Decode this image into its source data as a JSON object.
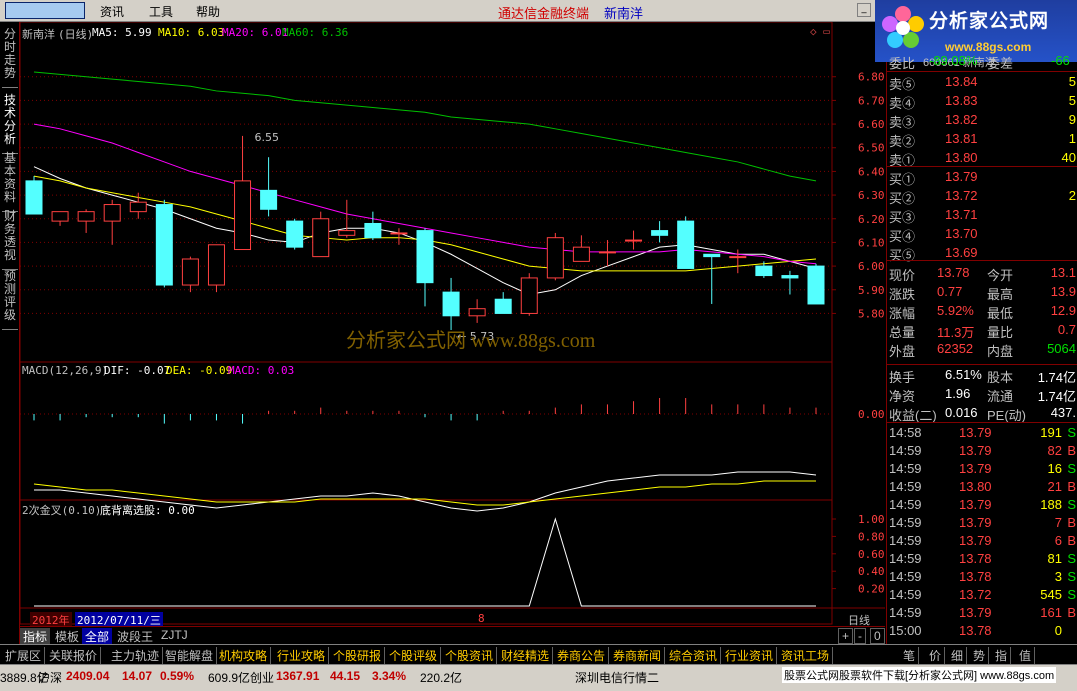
{
  "menu": {
    "items": [
      "资讯",
      "工具",
      "帮助"
    ],
    "app_title": "通达信金融终端",
    "stock_name": "新南洋",
    "min_button": "_"
  },
  "logo": {
    "text": "分析家公式网",
    "url": "www.88gs.com",
    "watermark": "分析家公式网 www.88gs.com"
  },
  "left_tabs": [
    "分时走势",
    "技术分析",
    "基本资料",
    "财务透视",
    "预测评级"
  ],
  "main_chart": {
    "header": {
      "name": "新南洋",
      "period": "(日线)",
      "ma5": "MA5: 5.99",
      "ma10": "MA10: 6.03",
      "ma20": "MA20: 6.01",
      "ma60": "MA60: 6.36"
    },
    "marks": {
      "high": "6.55",
      "low": "5.73"
    },
    "y_ticks": [
      "6.80",
      "6.70",
      "6.60",
      "6.50",
      "6.40",
      "6.30",
      "6.20",
      "6.10",
      "6.00",
      "5.90",
      "5.80"
    ]
  },
  "macd_panel": {
    "header": {
      "name": "MACD(12,26,9)",
      "dif": "DIF: -0.07",
      "dea": "DEA: -0.09",
      "macd": "MACD: 0.03"
    },
    "y_tick": "0.00"
  },
  "signal_panel": {
    "header": {
      "name": "2次金叉(0.10)",
      "value": "底背离选股: 0.00"
    },
    "y_ticks": [
      "1.00",
      "0.80",
      "0.60",
      "0.40",
      "0.20"
    ]
  },
  "time_axis": {
    "year": "2012年",
    "cursor_date": "2012/07/11/三",
    "month": "8",
    "period": "日线"
  },
  "chart_data": [
    {
      "type": "candlestick",
      "title": "新南洋(日线)",
      "ylim": [
        5.73,
        6.82
      ],
      "candles": [
        {
          "o": 6.36,
          "h": 6.38,
          "l": 6.22,
          "c": 6.22
        },
        {
          "o": 6.19,
          "h": 6.23,
          "l": 6.17,
          "c": 6.23
        },
        {
          "o": 6.19,
          "h": 6.24,
          "l": 6.14,
          "c": 6.23
        },
        {
          "o": 6.19,
          "h": 6.28,
          "l": 6.09,
          "c": 6.26
        },
        {
          "o": 6.23,
          "h": 6.31,
          "l": 6.2,
          "c": 6.27
        },
        {
          "o": 6.26,
          "h": 6.28,
          "l": 5.91,
          "c": 5.92
        },
        {
          "o": 5.92,
          "h": 6.04,
          "l": 5.89,
          "c": 6.03
        },
        {
          "o": 5.92,
          "h": 6.08,
          "l": 5.89,
          "c": 6.09
        },
        {
          "o": 6.07,
          "h": 6.55,
          "l": 6.07,
          "c": 6.36
        },
        {
          "o": 6.32,
          "h": 6.46,
          "l": 6.21,
          "c": 6.24
        },
        {
          "o": 6.19,
          "h": 6.2,
          "l": 6.07,
          "c": 6.08
        },
        {
          "o": 6.04,
          "h": 6.23,
          "l": 6.04,
          "c": 6.2
        },
        {
          "o": 6.13,
          "h": 6.28,
          "l": 6.12,
          "c": 6.15
        },
        {
          "o": 6.18,
          "h": 6.23,
          "l": 6.11,
          "c": 6.12
        },
        {
          "o": 6.14,
          "h": 6.16,
          "l": 6.09,
          "c": 6.14
        },
        {
          "o": 6.15,
          "h": 6.16,
          "l": 5.83,
          "c": 5.93
        },
        {
          "o": 5.89,
          "h": 5.95,
          "l": 5.73,
          "c": 5.79
        },
        {
          "o": 5.79,
          "h": 5.86,
          "l": 5.76,
          "c": 5.82
        },
        {
          "o": 5.86,
          "h": 5.89,
          "l": 5.8,
          "c": 5.8
        },
        {
          "o": 5.8,
          "h": 5.97,
          "l": 5.79,
          "c": 5.95
        },
        {
          "o": 5.95,
          "h": 6.14,
          "l": 5.94,
          "c": 6.12
        },
        {
          "o": 6.02,
          "h": 6.13,
          "l": 6.02,
          "c": 6.08
        },
        {
          "o": 6.06,
          "h": 6.11,
          "l": 6.0,
          "c": 6.06
        },
        {
          "o": 6.11,
          "h": 6.15,
          "l": 6.07,
          "c": 6.11
        },
        {
          "o": 6.15,
          "h": 6.19,
          "l": 6.1,
          "c": 6.13
        },
        {
          "o": 6.19,
          "h": 6.21,
          "l": 6.0,
          "c": 5.99
        },
        {
          "o": 6.05,
          "h": 6.05,
          "l": 5.84,
          "c": 6.04
        },
        {
          "o": 6.04,
          "h": 6.07,
          "l": 5.97,
          "c": 6.04
        },
        {
          "o": 6.0,
          "h": 6.02,
          "l": 5.95,
          "c": 5.96
        },
        {
          "o": 5.96,
          "h": 5.98,
          "l": 5.88,
          "c": 5.95
        },
        {
          "o": 6.0,
          "h": 6.01,
          "l": 5.84,
          "c": 5.84
        }
      ],
      "series": [
        {
          "name": "MA5",
          "color": "#ffffff",
          "values": [
            6.42,
            6.37,
            6.33,
            6.3,
            6.27,
            6.24,
            6.2,
            6.16,
            6.14,
            6.11,
            6.1,
            6.14,
            6.16,
            6.16,
            6.14,
            6.1,
            6.05,
            5.99,
            5.93,
            5.88,
            5.9,
            5.96,
            6.0,
            6.04,
            6.08,
            6.09,
            6.07,
            6.05,
            6.05,
            6.02,
            5.99
          ]
        },
        {
          "name": "MA10",
          "color": "#ffff00",
          "values": [
            6.38,
            6.36,
            6.33,
            6.31,
            6.29,
            6.27,
            6.25,
            6.22,
            6.19,
            6.16,
            6.13,
            6.12,
            6.11,
            6.12,
            6.12,
            6.11,
            6.09,
            6.06,
            6.03,
            6.0,
            5.99,
            5.98,
            5.98,
            5.98,
            5.98,
            5.98,
            5.99,
            6.0,
            6.01,
            6.02,
            6.03
          ]
        },
        {
          "name": "MA20",
          "color": "#ff00ff",
          "values": [
            6.6,
            6.58,
            6.55,
            6.52,
            6.48,
            6.44,
            6.4,
            6.37,
            6.34,
            6.31,
            6.28,
            6.25,
            6.22,
            6.2,
            6.18,
            6.16,
            6.14,
            6.12,
            6.1,
            6.08,
            6.07,
            6.06,
            6.06,
            6.06,
            6.06,
            6.07,
            6.06,
            6.05,
            6.04,
            6.02,
            6.01
          ]
        },
        {
          "name": "MA60",
          "color": "#00c000",
          "values": [
            6.82,
            6.81,
            6.8,
            6.79,
            6.78,
            6.77,
            6.76,
            6.74,
            6.73,
            6.72,
            6.7,
            6.69,
            6.68,
            6.67,
            6.66,
            6.65,
            6.63,
            6.62,
            6.61,
            6.6,
            6.58,
            6.56,
            6.54,
            6.52,
            6.5,
            6.48,
            6.46,
            6.44,
            6.41,
            6.38,
            6.36
          ]
        }
      ]
    },
    {
      "type": "bar",
      "title": "MACD(12,26,9)",
      "ylim": [
        -0.08,
        0.07
      ],
      "values": [
        -0.02,
        -0.02,
        -0.01,
        -0.01,
        -0.01,
        -0.03,
        -0.02,
        -0.02,
        -0.03,
        0.01,
        0.01,
        0.02,
        0.01,
        0.01,
        0.01,
        -0.01,
        -0.02,
        -0.02,
        0.01,
        0.01,
        0.02,
        0.03,
        0.03,
        0.04,
        0.05,
        0.05,
        0.03,
        0.03,
        0.03,
        0.02,
        0.02
      ],
      "series": [
        {
          "name": "DIF",
          "color": "#ffffff",
          "values": [
            -0.12,
            -0.12,
            -0.13,
            -0.14,
            -0.15,
            -0.16,
            -0.17,
            -0.18,
            -0.17,
            -0.16,
            -0.15,
            -0.14,
            -0.14,
            -0.13,
            -0.14,
            -0.16,
            -0.18,
            -0.19,
            -0.18,
            -0.16,
            -0.13,
            -0.11,
            -0.09,
            -0.08,
            -0.07,
            -0.07,
            -0.07,
            -0.06,
            -0.06,
            -0.06,
            -0.07
          ]
        },
        {
          "name": "DEA",
          "color": "#ffff00",
          "values": [
            -0.1,
            -0.11,
            -0.12,
            -0.12,
            -0.13,
            -0.14,
            -0.15,
            -0.16,
            -0.16,
            -0.16,
            -0.16,
            -0.15,
            -0.15,
            -0.15,
            -0.15,
            -0.15,
            -0.16,
            -0.17,
            -0.17,
            -0.16,
            -0.15,
            -0.14,
            -0.13,
            -0.12,
            -0.11,
            -0.11,
            -0.1,
            -0.1,
            -0.09,
            -0.09,
            -0.09
          ]
        }
      ]
    },
    {
      "type": "line",
      "title": "2次金叉(0.10)",
      "ylim": [
        0,
        1.0
      ],
      "series": [
        {
          "name": "底背离选股",
          "color": "#ffffff",
          "values": [
            0,
            0,
            0,
            0,
            0,
            0,
            0,
            0,
            0,
            0,
            0,
            0,
            0,
            0,
            0,
            0,
            0,
            0,
            0,
            0,
            1,
            0,
            0,
            0,
            0,
            0,
            0,
            0,
            0,
            0,
            0
          ]
        }
      ]
    }
  ],
  "quote": {
    "weibi": {
      "label": "委比",
      "value": "-89.08%",
      "diff_label": "委差",
      "diff": "-66"
    },
    "code_line": "600661 新南洋",
    "sells": [
      {
        "label": "卖⑤",
        "price": "13.84",
        "vol": "5"
      },
      {
        "label": "卖④",
        "price": "13.83",
        "vol": "5"
      },
      {
        "label": "卖③",
        "price": "13.82",
        "vol": "9"
      },
      {
        "label": "卖②",
        "price": "13.81",
        "vol": "1"
      },
      {
        "label": "卖①",
        "price": "13.80",
        "vol": "40"
      }
    ],
    "buys": [
      {
        "label": "买①",
        "price": "13.79",
        "vol": ""
      },
      {
        "label": "买②",
        "price": "13.72",
        "vol": "2"
      },
      {
        "label": "买③",
        "price": "13.71",
        "vol": ""
      },
      {
        "label": "买④",
        "price": "13.70",
        "vol": ""
      },
      {
        "label": "买⑤",
        "price": "13.69",
        "vol": ""
      }
    ],
    "stats": [
      {
        "l1": "现价",
        "v1": "13.78",
        "l2": "今开",
        "v2": "13.1"
      },
      {
        "l1": "涨跌",
        "v1": "0.77",
        "l2": "最高",
        "v2": "13.9"
      },
      {
        "l1": "涨幅",
        "v1": "5.92%",
        "l2": "最低",
        "v2": "12.9"
      },
      {
        "l1": "总量",
        "v1": "11.3万",
        "l2": "量比",
        "v2": "0.7"
      },
      {
        "l1": "外盘",
        "v1": "62352",
        "l2": "内盘",
        "v2": "5064"
      }
    ],
    "stats2": [
      {
        "l1": "换手",
        "v1": "6.51%",
        "l2": "股本",
        "v2": "1.74亿"
      },
      {
        "l1": "净资",
        "v1": "1.96",
        "l2": "流通",
        "v2": "1.74亿"
      },
      {
        "l1": "收益(二)",
        "v1": "0.016",
        "l2": "PE(动)",
        "v2": "437."
      }
    ],
    "ticks": [
      {
        "t": "14:58",
        "p": "13.79",
        "v": "191",
        "f": "S"
      },
      {
        "t": "14:59",
        "p": "13.79",
        "v": "82",
        "f": "B"
      },
      {
        "t": "14:59",
        "p": "13.79",
        "v": "16",
        "f": "S"
      },
      {
        "t": "14:59",
        "p": "13.80",
        "v": "21",
        "f": "B"
      },
      {
        "t": "14:59",
        "p": "13.79",
        "v": "188",
        "f": "S"
      },
      {
        "t": "14:59",
        "p": "13.79",
        "v": "7",
        "f": "B"
      },
      {
        "t": "14:59",
        "p": "13.79",
        "v": "6",
        "f": "B"
      },
      {
        "t": "14:59",
        "p": "13.78",
        "v": "81",
        "f": "S"
      },
      {
        "t": "14:59",
        "p": "13.78",
        "v": "3",
        "f": "S"
      },
      {
        "t": "14:59",
        "p": "13.72",
        "v": "545",
        "f": "S"
      },
      {
        "t": "14:59",
        "p": "13.79",
        "v": "161",
        "f": "B"
      },
      {
        "t": "15:00",
        "p": "13.78",
        "v": "0",
        "f": ""
      }
    ]
  },
  "bottom_tabs": [
    "指标",
    "模板",
    "全部",
    "波段王",
    "ZJTJ"
  ],
  "nav_buttons": [
    "+",
    "-",
    "0"
  ],
  "info_tabs": [
    "扩展区",
    "关联报价",
    "主力轨迹",
    "智能解盘",
    "机构攻略",
    "行业攻略",
    "个股研报",
    "个股评级",
    "个股资讯",
    "财经精选",
    "券商公告",
    "券商新闻",
    "综合资讯",
    "行业资讯",
    "资讯工场"
  ],
  "right_bottom_tabs": [
    "笔",
    "价",
    "细",
    "势",
    "指",
    "值"
  ],
  "status": {
    "prefix": "3889.8亿",
    "sh_label": "沪深",
    "sh_value": "2409.04",
    "sh_change": "14.07",
    "sh_pct": "0.59%",
    "amount1": "609.9亿",
    "cy_label": "创业",
    "cy_value": "1367.91",
    "cy_change": "44.15",
    "cy_pct": "3.34%",
    "amount2": "220.2亿",
    "server": "深圳电信行情二",
    "ad": "股票公式网股票软件下载[分析家公式网] www.88gs.com"
  }
}
